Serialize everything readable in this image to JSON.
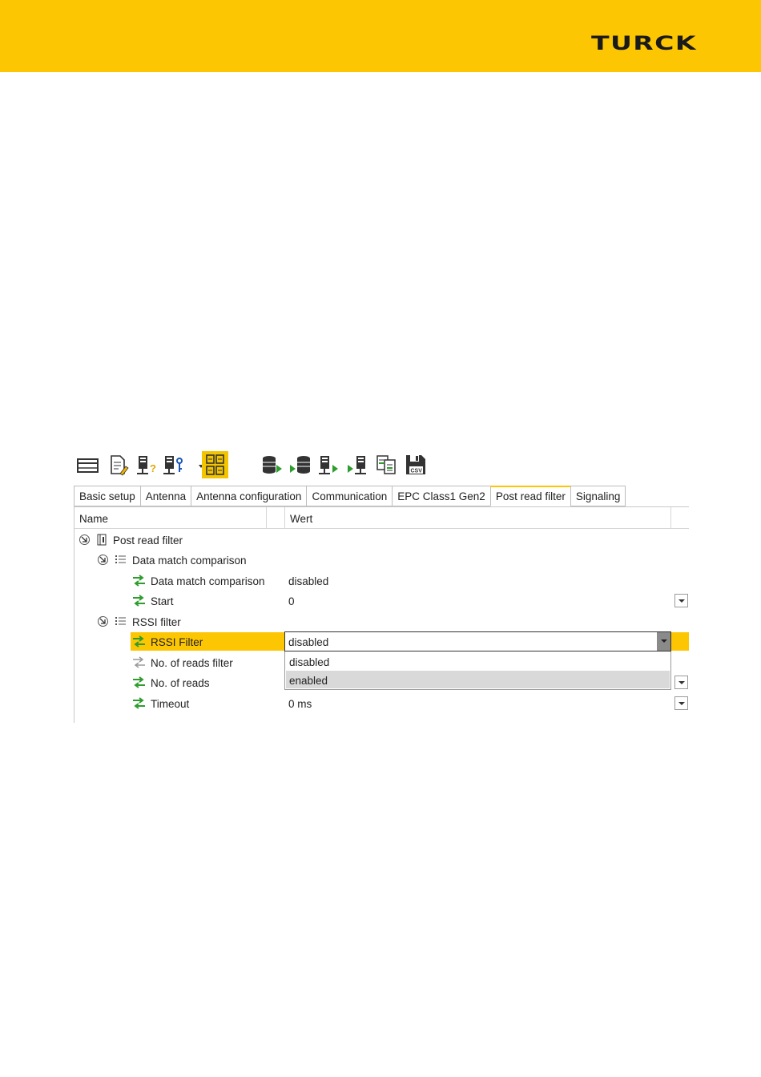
{
  "header": {
    "brand": "TURCK",
    "color": "#fdc603"
  },
  "toolbar": {
    "buttons": [
      {
        "name": "panel-layout-icon"
      },
      {
        "name": "edit-document-icon"
      },
      {
        "name": "device-help-icon"
      },
      {
        "name": "device-key-icon"
      },
      {
        "name": "grid-view-icon",
        "active": true
      },
      {
        "name": "database-read-icon"
      },
      {
        "name": "database-write-icon"
      },
      {
        "name": "device-read-icon"
      },
      {
        "name": "device-write-icon"
      },
      {
        "name": "compare-documents-icon"
      },
      {
        "name": "save-csv-icon",
        "label": "CSV"
      }
    ]
  },
  "tabs": [
    "Basic setup",
    "Antenna",
    "Antenna configuration",
    "Communication",
    "EPC Class1 Gen2",
    "Post read filter",
    "Signaling"
  ],
  "active_tab": "Post read filter",
  "grid": {
    "col_name": "Name",
    "col_value": "Wert",
    "rows": [
      {
        "name": "Post read filter",
        "value": ""
      },
      {
        "name": "Data match comparison",
        "value": ""
      },
      {
        "name": "Data match comparison",
        "value": "disabled"
      },
      {
        "name": "Start",
        "value": "0"
      },
      {
        "name": "RSSI filter",
        "value": ""
      },
      {
        "name": "RSSI Filter",
        "value": "disabled"
      },
      {
        "name": "No. of reads filter",
        "value": ""
      },
      {
        "name": "No. of reads",
        "value": ""
      },
      {
        "name": "Timeout",
        "value": "0 ms"
      }
    ]
  },
  "dropdown": {
    "current": "disabled",
    "options": [
      "disabled",
      "enabled"
    ],
    "highlighted": "enabled"
  },
  "colors": {
    "accent": "#fdc603",
    "green": "#2e9d2e",
    "gray_icon": "#9a9a9a"
  }
}
